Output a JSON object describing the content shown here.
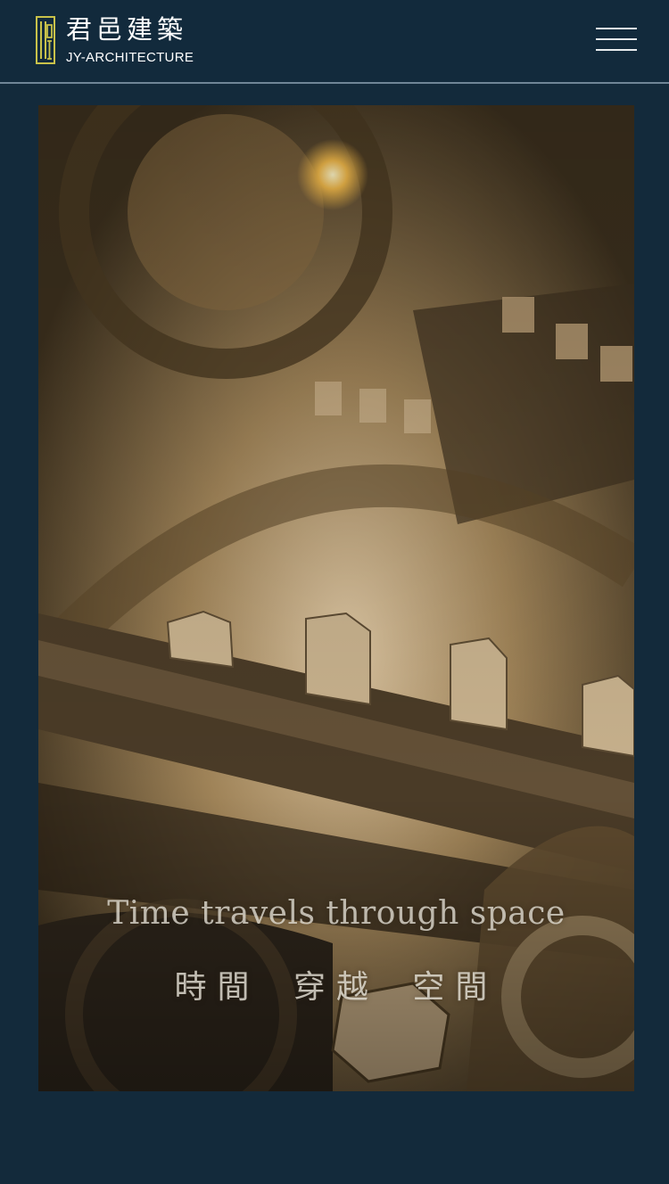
{
  "brand": {
    "name_cn": "君邑建築",
    "name_en": "JY-ARCHITECTURE",
    "accent_color": "#c9c24a"
  },
  "header": {
    "menu_icon": "hamburger-menu-icon"
  },
  "hero": {
    "tagline_en": "Time travels through space",
    "tagline_cn": "時間 穿越 空間"
  }
}
